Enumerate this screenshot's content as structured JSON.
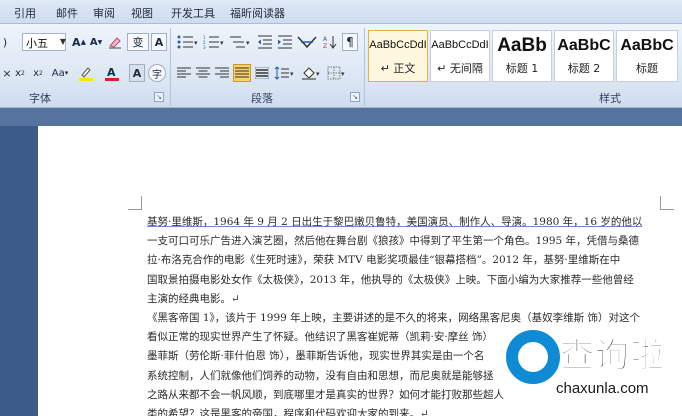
{
  "menu": {
    "tabs": [
      "引用",
      "邮件",
      "审阅",
      "视图",
      "开发工具",
      "福昕阅读器"
    ]
  },
  "ribbon": {
    "font": {
      "size_value": "小五",
      "group_label": "字体"
    },
    "paragraph": {
      "group_label": "段落"
    },
    "styles": {
      "group_label": "样式",
      "items": [
        {
          "sample": "AaBbCcDdI",
          "name": "↵ 正文"
        },
        {
          "sample": "AaBbCcDdI",
          "name": "↵ 无间隔"
        },
        {
          "sample": "AaBb",
          "name": "标题 1"
        },
        {
          "sample": "AaBbC",
          "name": "标题 2"
        },
        {
          "sample": "AaBbC",
          "name": "标题"
        }
      ]
    }
  },
  "document": {
    "lines": [
      "基努·里维斯，1964 年 9 月 2 日出生于黎巴嫩贝鲁特，美国演员、制作人、导演。1980 年，16 岁的他以",
      "一支可口可乐广告进入演艺圈，然后他在舞台剧《狼孩》中得到了平生第一个角色。1995 年，凭借与桑德",
      "拉·布洛克合作的电影《生死时速》，荣获 MTV 电影奖项最佳“银幕搭档”。2012 年，基努·里维斯在中",
      "国取景拍摄电影处女作《太极侠》，2013 年，他执导的《太极侠》上映。下面小编为大家推荐一些他曾经",
      "主演的经典电影。↵",
      "《黑客帝国 1》，该片于 1999 年上映，主要讲述的是不久的将来，网络黑客尼奥（基奴李维斯 饰）对这个",
      "看似正常的现实世界产生了怀疑。他结识了黑客崔妮蒂（凯莉·安·摩丝 饰）",
      "墨菲斯（劳伦斯·菲什伯恩 饰），墨菲斯告诉他，现实世界其实是由一个名",
      "系统控制，人们就像他们饲养的动物，没有自由和思想，而尼奥就是能够拯",
      "之路从来都不会一帆风顺，到底哪里才是真实的世界？如何才能打败那些超人",
      "类的希望？这是黑客的帝国，程序和代码欢迎大家的到来。↵"
    ]
  },
  "watermark": {
    "brand": "查询啦",
    "url": "chaxunla.com"
  },
  "colors": {
    "accent_link": "#2f5fb0",
    "watermark_blue": "#0f8bd6",
    "doc_background": "#3c5a8a"
  }
}
